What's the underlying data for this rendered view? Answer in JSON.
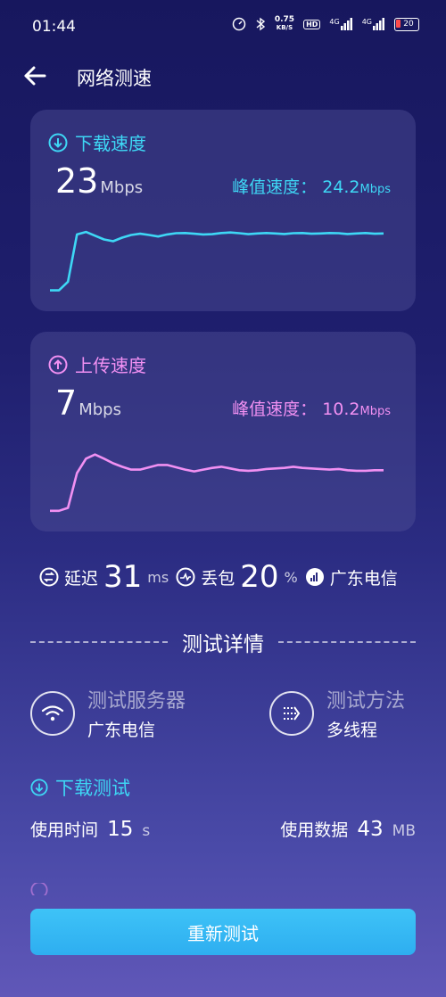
{
  "status_bar": {
    "time": "01:44",
    "net_speed_value": "0.75",
    "net_speed_unit": "KB/S",
    "hd_label": "HD",
    "signal1_label": "4G",
    "signal2_label": "4G",
    "battery_level": "20"
  },
  "header": {
    "title": "网络测速"
  },
  "download": {
    "title": "下载速度",
    "value": "23",
    "unit": "Mbps",
    "peak_label": "峰值速度：",
    "peak_value": "24.2",
    "peak_unit": "Mbps",
    "color": "#3ed7f5",
    "chart_data": {
      "type": "line",
      "x": [
        0,
        1,
        2,
        3,
        4,
        5,
        6,
        7,
        8,
        9,
        10,
        11,
        12,
        13,
        14,
        15,
        16,
        17,
        18,
        19,
        20,
        21,
        22,
        23,
        24,
        25,
        26,
        27,
        28,
        29,
        30,
        31,
        32,
        33,
        34,
        35,
        36,
        37
      ],
      "values": [
        0.5,
        0.5,
        4,
        23,
        24,
        22.5,
        21,
        20.3,
        21.7,
        22.8,
        23.3,
        22.8,
        22.2,
        23,
        23.5,
        23.6,
        23.3,
        23,
        23.1,
        23.6,
        23.8,
        23.5,
        23.1,
        23.4,
        23.6,
        23.4,
        23.2,
        23.5,
        23.6,
        23.3,
        23.4,
        23.6,
        23.5,
        23.2,
        23.4,
        23.6,
        23.3,
        23.4
      ],
      "ylim": [
        0,
        28
      ]
    }
  },
  "upload": {
    "title": "上传速度",
    "value": "7",
    "unit": "Mbps",
    "peak_label": "峰值速度：",
    "peak_value": "10.2",
    "peak_unit": "Mbps",
    "color": "#f190f2",
    "chart_data": {
      "type": "line",
      "x": [
        0,
        1,
        2,
        3,
        4,
        5,
        6,
        7,
        8,
        9,
        10,
        11,
        12,
        13,
        14,
        15,
        16,
        17,
        18,
        19,
        20,
        21,
        22,
        23,
        24,
        25,
        26,
        27,
        28,
        29,
        30,
        31,
        32,
        33,
        34,
        35,
        36,
        37
      ],
      "values": [
        0.5,
        0.5,
        1,
        7,
        9.5,
        10.2,
        9.5,
        8.7,
        8.1,
        7.6,
        7.6,
        8,
        8.4,
        8.4,
        8,
        7.6,
        7.3,
        7.6,
        7.9,
        8.1,
        7.8,
        7.5,
        7.4,
        7.5,
        7.7,
        7.8,
        7.9,
        8.1,
        7.9,
        7.8,
        7.7,
        7.6,
        7.7,
        7.5,
        7.4,
        7.4,
        7.5,
        7.5
      ],
      "ylim": [
        0,
        12
      ]
    }
  },
  "stats": {
    "latency_label": "延迟",
    "latency_value": "31",
    "latency_unit": "ms",
    "loss_label": "丢包",
    "loss_value": "20",
    "loss_unit": "%",
    "isp": "广东电信"
  },
  "details": {
    "section_title": "测试详情",
    "server_label": "测试服务器",
    "server_value": "广东电信",
    "method_label": "测试方法",
    "method_value": "多线程"
  },
  "download_test": {
    "title": "下载测试",
    "time_label": "使用时间",
    "time_value": "15",
    "time_unit": "s",
    "data_label": "使用数据",
    "data_value": "43",
    "data_unit": "MB"
  },
  "retest_button": {
    "label": "重新测试"
  }
}
